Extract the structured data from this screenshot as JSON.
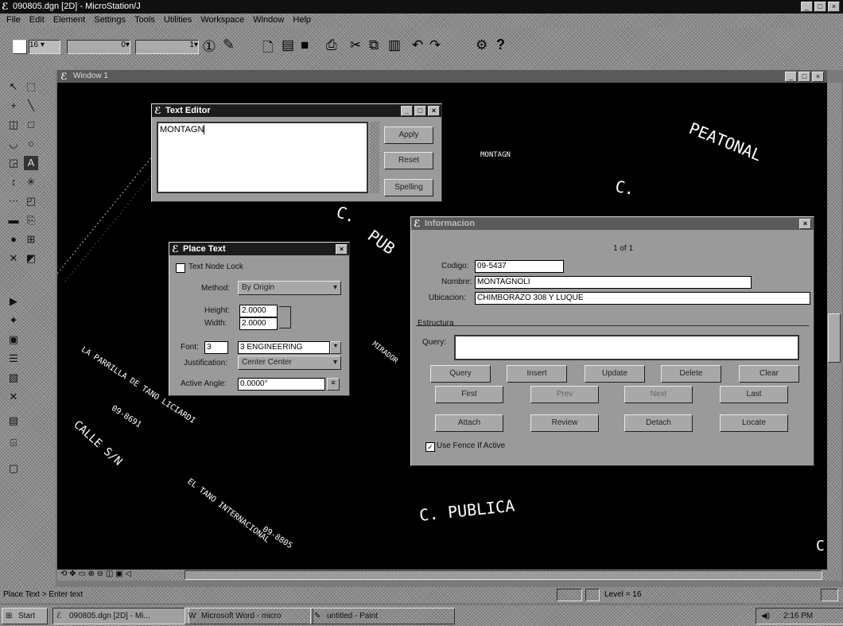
{
  "window": {
    "title": "090805.dgn [2D] - MicroStation/J"
  },
  "menu": [
    "File",
    "Edit",
    "Element",
    "Settings",
    "Tools",
    "Utilities",
    "Workspace",
    "Window",
    "Help"
  ],
  "toolbar": {
    "level": "16",
    "weight": "0",
    "style": "1",
    "info_icon": "info-icon"
  },
  "view": {
    "title": "Window 1"
  },
  "drawing_texts": {
    "peatonal": "PEATONAL",
    "c_top": "C.",
    "c_mid": "C.",
    "pub": "PUB",
    "mirador": "MIRADOR",
    "parrilla": "LA PARRILLA DE TANO LICIARDI",
    "code1": "09-8691",
    "calle": "CALLE S/N",
    "tano": "EL TANO INTERNACIONAL",
    "code2": "09-8805",
    "publica": "C. PUBLICA",
    "montagn_small": "MONTAGN",
    "c_right": "C"
  },
  "text_editor": {
    "title": "Text Editor",
    "content": "MONTAGN",
    "buttons": [
      "Apply",
      "Reset",
      "Spelling"
    ]
  },
  "place_text": {
    "title": "Place Text",
    "text_node_lock": "Text Node Lock",
    "method_label": "Method:",
    "method_value": "By Origin",
    "height_label": "Height:",
    "height_value": "2.0000",
    "width_label": "Width:",
    "width_value": "2.0000",
    "font_label": "Font:",
    "font_num": "3",
    "font_value": "3    ENGINEERING",
    "justification_label": "Justification:",
    "justification_value": "Center Center",
    "angle_label": "Active Angle:",
    "angle_value": "0.0000°"
  },
  "info_dialog": {
    "title": "Informacion",
    "counter": "1 of 1",
    "codigo_label": "Codigo:",
    "codigo_value": "09-5437",
    "nombre_label": "Nombre:",
    "nombre_value": "MONTAGNOLI",
    "ubicacion_label": "Ubicacion:",
    "ubicacion_value": "CHIMBORAZO 308 Y LUQUE",
    "section_label": "Estructura",
    "query_label": "Query:",
    "row1": [
      "Query",
      "Insert",
      "Update",
      "Delete",
      "Clear"
    ],
    "row2": [
      "First",
      "Prev",
      "Next",
      "Last"
    ],
    "row3": [
      "Attach",
      "Review",
      "Detach",
      "Locate"
    ],
    "checkbox_label": "Use Fence If Active"
  },
  "status": {
    "left": "Place Text > Enter text",
    "level": "Level = 16"
  },
  "taskbar": {
    "start": "Start",
    "tasks": [
      "090805.dgn [2D] - Mi...",
      "Microsoft Word - micro",
      "untitled - Paint"
    ],
    "clock": "2:16 PM"
  }
}
